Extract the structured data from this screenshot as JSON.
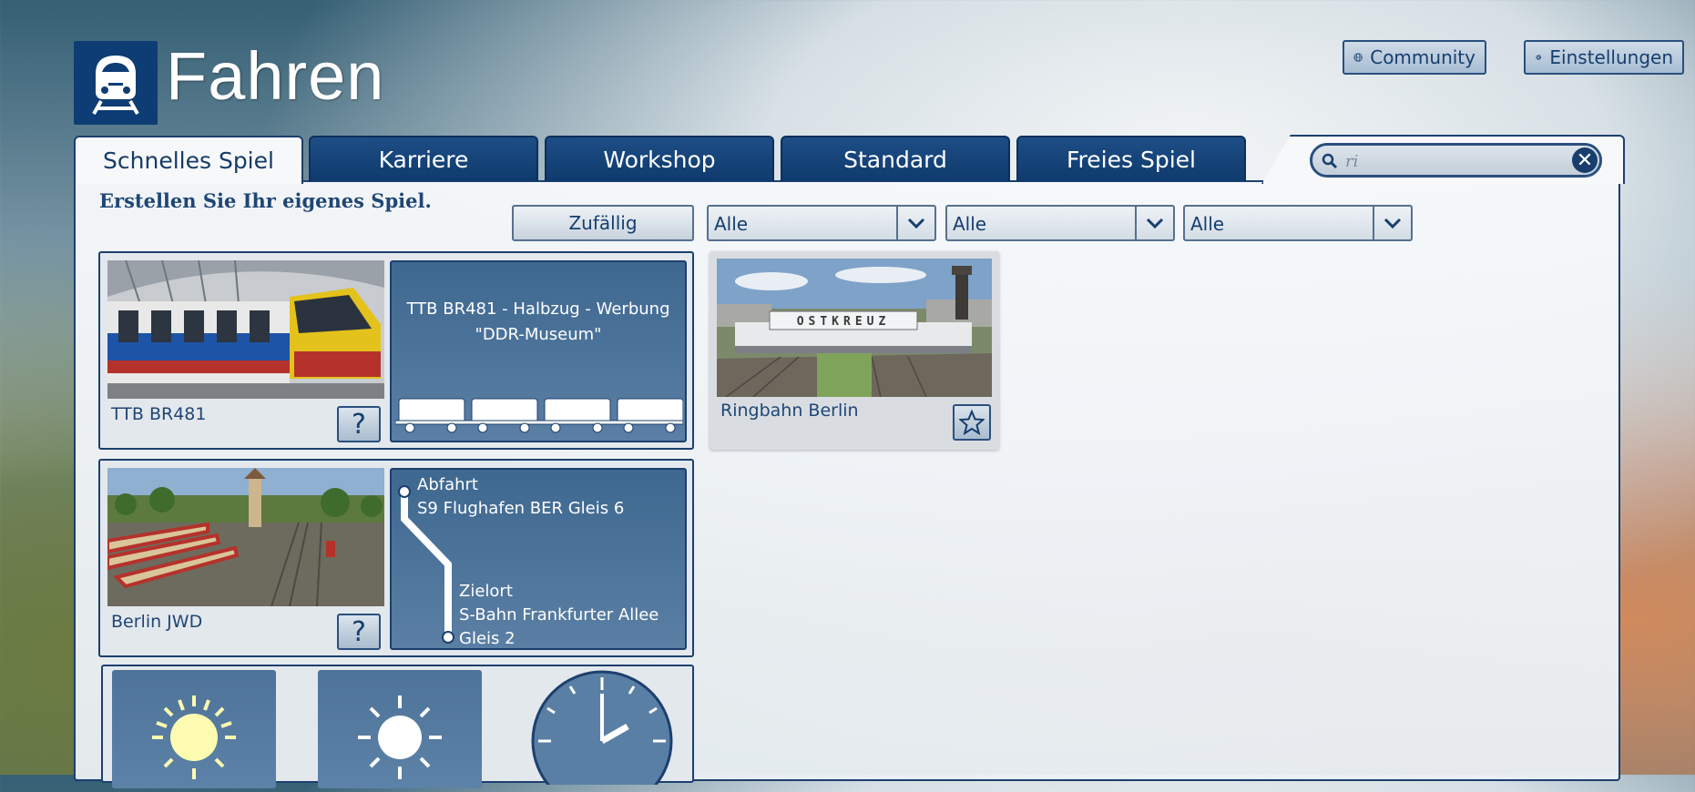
{
  "header": {
    "title": "Fahren"
  },
  "top_buttons": {
    "community": "Community",
    "settings": "Einstellungen"
  },
  "tabs": [
    {
      "label": "Schnelles Spiel",
      "active": true
    },
    {
      "label": "Karriere"
    },
    {
      "label": "Workshop"
    },
    {
      "label": "Standard"
    },
    {
      "label": "Freies Spiel"
    }
  ],
  "search": {
    "value": "ri",
    "icon": "search-icon"
  },
  "subtitle": "Erstellen Sie Ihr eigenes Spiel.",
  "filters": {
    "random_label": "Zufällig",
    "dropdowns": [
      "Alle",
      "Alle",
      "Alle"
    ]
  },
  "train_card": {
    "name": "TTB BR481",
    "help": "?",
    "description": "TTB BR481 - Halbzug - Werbung \"DDR-Museum\"",
    "wagon_count": 4
  },
  "scenario_card": {
    "name": "Berlin JWD",
    "help": "?",
    "departure_label": "Abfahrt",
    "departure_value": "S9 Flughafen BER Gleis 6",
    "destination_label": "Zielort",
    "destination_value": "S-Bahn Frankfurter Allee Gleis 2"
  },
  "route_card": {
    "name": "Ringbahn Berlin",
    "image_sign": "OSTKREUZ"
  },
  "colors": {
    "navy": "#0d3d74",
    "panel": "#f6f8fa",
    "accent": "#1f4675"
  }
}
